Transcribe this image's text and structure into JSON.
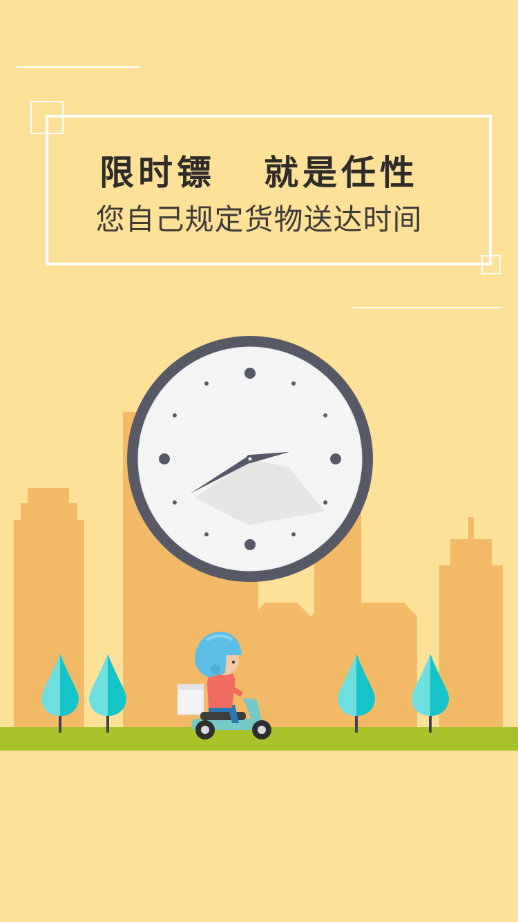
{
  "banner": {
    "headline_left": "限时镖",
    "headline_right": "就是任性",
    "subline": "您自己规定货物送达时间"
  },
  "colors": {
    "background": "#fde199",
    "buildings": "#f2b967",
    "ground": "#a8c32a",
    "tree_light": "#6ddfe0",
    "tree_dark": "#16c3c9",
    "clock_rim": "#575a66",
    "clock_face": "#f4f4f4",
    "text": "#2f2b29"
  },
  "clock": {
    "hour": 2,
    "minute": 40
  }
}
